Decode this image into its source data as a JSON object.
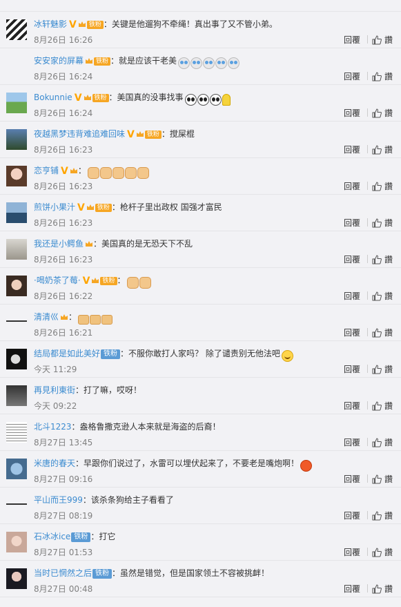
{
  "reply_label": "回覆",
  "like_label": "讚",
  "comments": [
    {
      "user": "冰轩魅影",
      "user_color": "blue",
      "v": true,
      "fan": "铁粉",
      "fan_style": "orange",
      "text": "：关键是他遛狗不牵绳！真出事了又不管小弟。",
      "emojis": [],
      "time": "8月26日 16:26",
      "avatar": "stripes"
    },
    {
      "user": "安安家的屏幕",
      "user_color": "blue",
      "v": false,
      "fan": "铁粉",
      "fan_style": "orange",
      "text": "：就是应该干老美",
      "emojis": [
        "cry",
        "cry",
        "cry",
        "cry",
        "cry"
      ],
      "time": "8月26日 16:24",
      "avatar": "blank"
    },
    {
      "user": "Bokunnie",
      "user_color": "blue",
      "v": true,
      "fan": "铁粉",
      "fan_style": "orange",
      "text": "：美国真的没事找事",
      "emojis": [
        "sweat",
        "sweat",
        "sweat",
        "lemon"
      ],
      "time": "8月26日 16:24",
      "avatar": "field"
    },
    {
      "user": "夜越黑梦违背难追难回味",
      "user_color": "blue",
      "v": true,
      "fan": "铁粉",
      "fan_style": "orange",
      "text": "：搅屎棍",
      "emojis": [],
      "time": "8月26日 16:23",
      "avatar": "tree"
    },
    {
      "user": "恋亨铺",
      "user_color": "blue",
      "v": true,
      "fan": "",
      "fan_style": "orange",
      "text": "：",
      "emojis": [
        "fist",
        "fist",
        "fist",
        "fist",
        "fist"
      ],
      "time": "8月26日 16:23",
      "avatar": "girl"
    },
    {
      "user": "煎饼小果汁",
      "user_color": "blue",
      "v": true,
      "fan": "铁粉",
      "fan_style": "orange",
      "text": "：枪杆子里出政权 国强才富民",
      "emojis": [],
      "time": "8月26日 16:23",
      "avatar": "sea"
    },
    {
      "user": "我还是小鳄鱼",
      "user_color": "blue",
      "v": false,
      "fan": "",
      "fan_style": "orange",
      "text": "：美国真的是无恐天下不乱",
      "emojis": [],
      "time": "8月26日 16:23",
      "avatar": "room"
    },
    {
      "user": "·喝奶茶了莓·",
      "user_color": "blue",
      "v": true,
      "fan": "铁粉",
      "fan_style": "orange",
      "text": "：",
      "emojis": [
        "fist",
        "fist"
      ],
      "time": "8月26日 16:22",
      "avatar": "girl2"
    },
    {
      "user": "清清巛",
      "user_color": "blue",
      "v": false,
      "fan": "",
      "fan_style": "orange",
      "text": "：",
      "emojis": [
        "arm",
        "arm",
        "arm"
      ],
      "time": "8月26日 16:21",
      "avatar": "line"
    },
    {
      "user": "结局都是如此美好",
      "user_color": "blue",
      "v": false,
      "fan": "铁粉",
      "fan_style": "blue",
      "text": "：不服你敢打人家吗？ 除了谴责别无他法吧",
      "emojis": [
        "smile"
      ],
      "time": "今天 11:29",
      "avatar": "bw"
    },
    {
      "user": "再見利東街",
      "user_color": "blue",
      "v": false,
      "fan": "",
      "fan_style": "blue",
      "text": "：打了嘛，哎呀！",
      "emojis": [],
      "time": "今天 09:22",
      "avatar": "dark"
    },
    {
      "user": "北斗1223",
      "user_color": "blue",
      "v": false,
      "fan": "",
      "fan_style": "blue",
      "text": "：盎格鲁撒克逊人本来就是海盗的后裔！",
      "emojis": [],
      "time": "8月27日 13:45",
      "avatar": "text"
    },
    {
      "user": "米唐的春天",
      "user_color": "blue",
      "v": false,
      "fan": "",
      "fan_style": "blue",
      "text": "：早跟你们说过了，水雷可以埋伏起来了，不要老是嘴炮啊！",
      "emojis": [
        "angry"
      ],
      "time": "8月27日 09:16",
      "avatar": "blue"
    },
    {
      "user": "平山而王999",
      "user_color": "blue",
      "v": false,
      "fan": "",
      "fan_style": "blue",
      "text": "：该杀条狗给主子看看了",
      "emojis": [],
      "time": "8月27日 08:19",
      "avatar": "line"
    },
    {
      "user": "石冰冰ice",
      "user_color": "blue",
      "v": false,
      "fan": "铁粉",
      "fan_style": "blue",
      "text": "：打它",
      "emojis": [],
      "time": "8月27日 01:53",
      "avatar": "girl3"
    },
    {
      "user": "当时已惘然之后",
      "user_color": "blue",
      "v": false,
      "fan": "铁粉",
      "fan_style": "blue",
      "text": "：虽然是错觉，但是国家领土不容被挑衅！",
      "emojis": [],
      "time": "8月27日 00:48",
      "avatar": "night"
    }
  ]
}
